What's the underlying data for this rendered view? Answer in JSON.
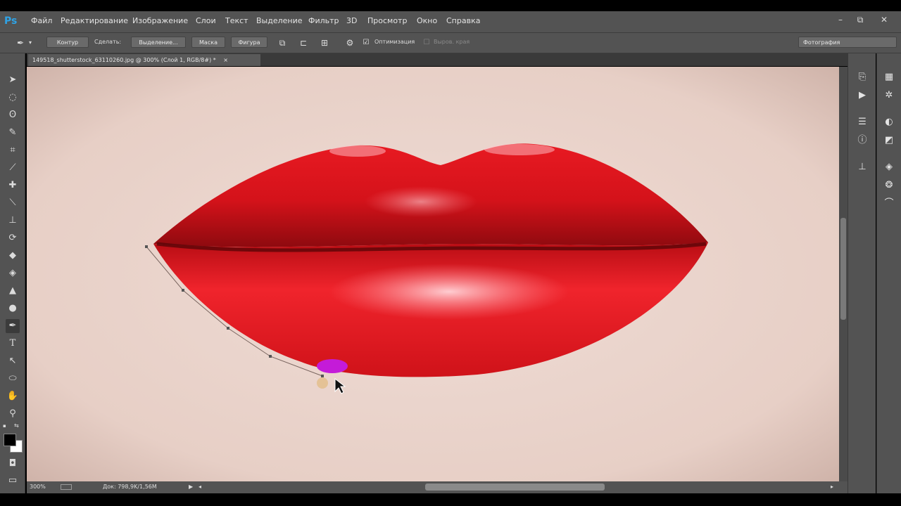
{
  "app": {
    "logo": "Ps"
  },
  "menu": [
    "Файл",
    "Редактирование",
    "Изображение",
    "Слои",
    "Текст",
    "Выделение",
    "Фильтр",
    "3D",
    "Просмотр",
    "Окно",
    "Справка"
  ],
  "window_controls": {
    "minimize": "–",
    "restore": "⧉",
    "close": "✕"
  },
  "options": {
    "mode": "Контур",
    "make_label": "Сделать:",
    "selection_btn": "Выделение...",
    "mask_btn": "Маска",
    "shape_btn": "Фигура",
    "optimize_label": "Оптимизация",
    "align_edges_label": "Выров. края",
    "workspace": "Фотография"
  },
  "document": {
    "tab": "149518_shutterstock_63110260.jpg @ 300% (Слой 1, RGB/8#) *",
    "close": "×"
  },
  "status": {
    "zoom": "300%",
    "doc": "Док: 798,9K/1,56M"
  },
  "colors": {
    "foreground": "#000000",
    "background": "#ffffff",
    "accent": "#2fa3e6",
    "lip": "#e3141c",
    "anchor_highlight": "#c41bd8"
  },
  "tools": [
    "move-icon",
    "ellipse-marquee-icon",
    "lasso-icon",
    "quick-select-icon",
    "crop-icon",
    "eyedropper-icon",
    "healing-brush-icon",
    "brush-icon",
    "clone-stamp-icon",
    "history-brush-icon",
    "eraser-icon",
    "paint-bucket-icon",
    "blur-icon",
    "dodge-icon",
    "pen-icon",
    "type-icon",
    "path-select-icon",
    "ellipse-shape-icon",
    "hand-icon",
    "zoom-icon"
  ]
}
